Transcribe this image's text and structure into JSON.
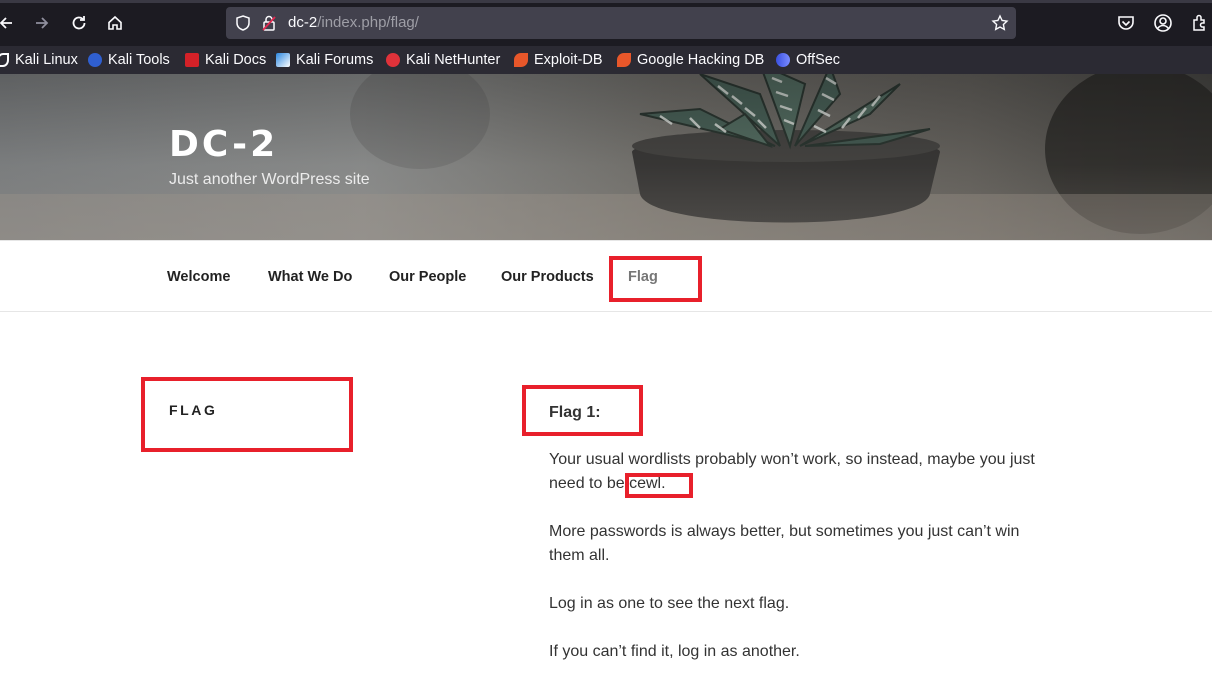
{
  "browser": {
    "url_host": "dc-2",
    "url_path": "/index.php/flag/",
    "bookmarks": [
      {
        "label": "Kali Linux",
        "color": "#ffffff"
      },
      {
        "label": "Kali Tools",
        "color": "#e0323a"
      },
      {
        "label": "Kali Docs",
        "color": "#d42128"
      },
      {
        "label": "Kali Forums",
        "color": "#2b87e0"
      },
      {
        "label": "Kali NetHunter",
        "color": "#e0323a"
      },
      {
        "label": "Exploit-DB",
        "color": "#e8572a"
      },
      {
        "label": "Google Hacking DB",
        "color": "#e8572a"
      },
      {
        "label": "OffSec",
        "color": "#4a6cf7"
      }
    ]
  },
  "site": {
    "title": "DC-2",
    "description": "Just another WordPress site"
  },
  "menu": {
    "items": [
      "Welcome",
      "What We Do",
      "Our People",
      "Our Products",
      "Flag"
    ],
    "current": "Flag"
  },
  "page": {
    "heading": "FLAG",
    "entry_title": "Flag 1:",
    "para1_before": "Your usual wordlists probably won’t work, so instead, maybe you just need to be ",
    "para1_highlight": "cewl.",
    "para2": "More passwords is always better, but sometimes you just can’t win them all.",
    "para3": "Log in as one to see the next flag.",
    "para4": "If you can’t find it, log in as another."
  },
  "colors": {
    "annotation": "#e8202b",
    "toolbar": "#1c1b22",
    "bookmarks_bar": "#2b2a33"
  }
}
